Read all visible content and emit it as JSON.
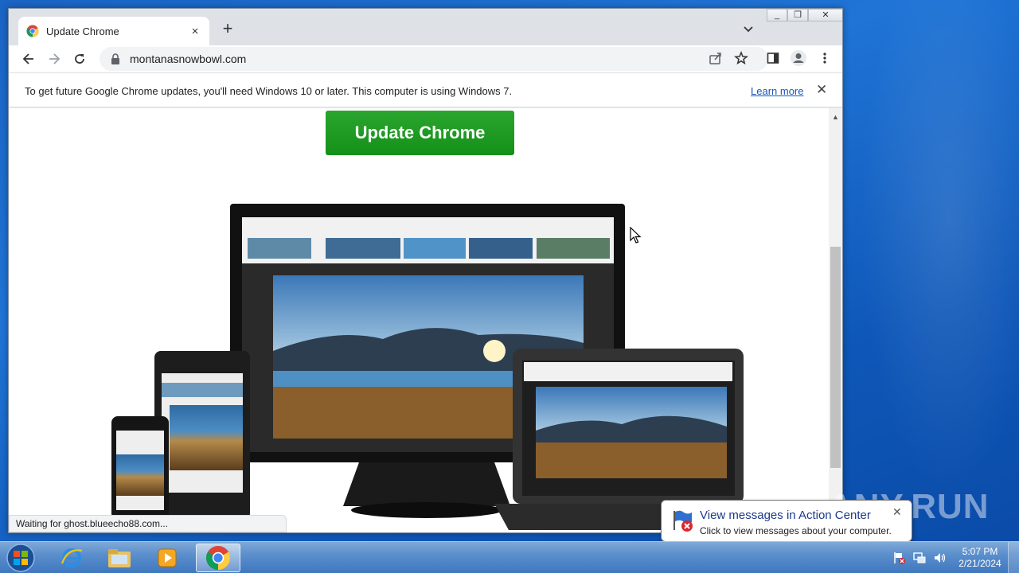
{
  "browser": {
    "tab_title": "Update Chrome",
    "tab_close": "×",
    "new_tab": "+",
    "url": "montanasnowbowl.com",
    "window_controls": [
      "—",
      "❐",
      "✕"
    ]
  },
  "infobar": {
    "message": "To get future Google Chrome updates, you'll need Windows 10 or later. This computer is using Windows 7.",
    "learn_more": "Learn more",
    "close": "✕"
  },
  "page": {
    "update_button": "Update Chrome",
    "hero_image_desc": "devices-showcase"
  },
  "status": {
    "text": "Waiting for ghost.blueecho88.com..."
  },
  "notification": {
    "title": "View messages in Action Center",
    "text": "Click to view messages about your computer.",
    "close": "✕"
  },
  "taskbar": {
    "items": [
      "internet-explorer",
      "file-explorer",
      "media-player",
      "google-chrome"
    ],
    "time": "5:07 PM",
    "date": "2/21/2024"
  },
  "watermark": "ANY.RUN",
  "colors": {
    "update_green": "#1a9a1e",
    "link_blue": "#1a56b8",
    "tab_strip": "#dee1e6"
  }
}
